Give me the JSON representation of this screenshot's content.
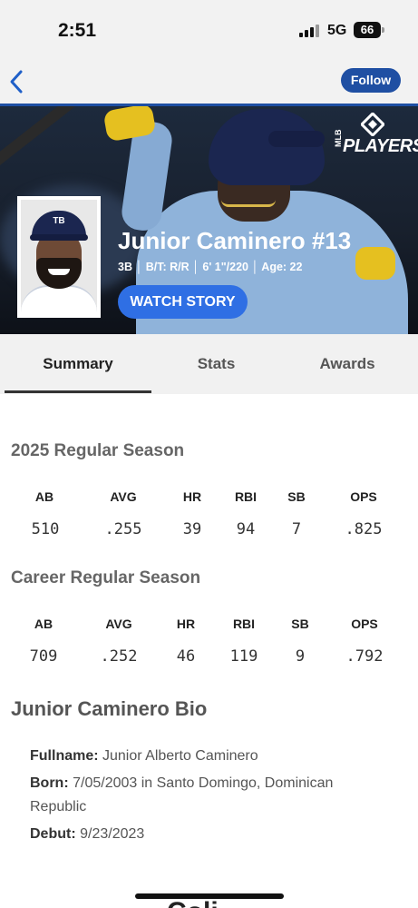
{
  "status_bar": {
    "time": "2:51",
    "network": "5G",
    "battery": "66"
  },
  "nav": {
    "follow_label": "Follow"
  },
  "hero": {
    "brand_logo_text": "PLAYERS",
    "brand_logo_prefix": "MLB",
    "player_name": "Junior Caminero #13",
    "player_meta": "3B │ B/T: R/R │ 6' 1\"/220 │ Age: 22",
    "headshot_cap_logo": "TB",
    "watch_story_label": "WATCH STORY"
  },
  "tabs": [
    {
      "label": "Summary",
      "active": true
    },
    {
      "label": "Stats",
      "active": false
    },
    {
      "label": "Awards",
      "active": false
    }
  ],
  "season_stats": {
    "title": "2025 Regular Season",
    "headers": [
      "AB",
      "AVG",
      "HR",
      "RBI",
      "SB",
      "OPS"
    ],
    "values": [
      "510",
      ".255",
      "39",
      "94",
      "7",
      ".825"
    ]
  },
  "career_stats": {
    "title": "Career Regular Season",
    "headers": [
      "AB",
      "AVG",
      "HR",
      "RBI",
      "SB",
      "OPS"
    ],
    "values": [
      "709",
      ".252",
      "46",
      "119",
      "9",
      ".792"
    ]
  },
  "bio": {
    "title": "Junior Caminero Bio",
    "fullname_label": "Fullname:",
    "fullname": " Junior Alberto Caminero",
    "born_label": "Born:",
    "born": " 7/05/2003 in Santo Domingo, Dominican Republic",
    "debut_label": "Debut:",
    "debut": " 9/23/2023"
  },
  "next_section_partial": "Coli"
}
